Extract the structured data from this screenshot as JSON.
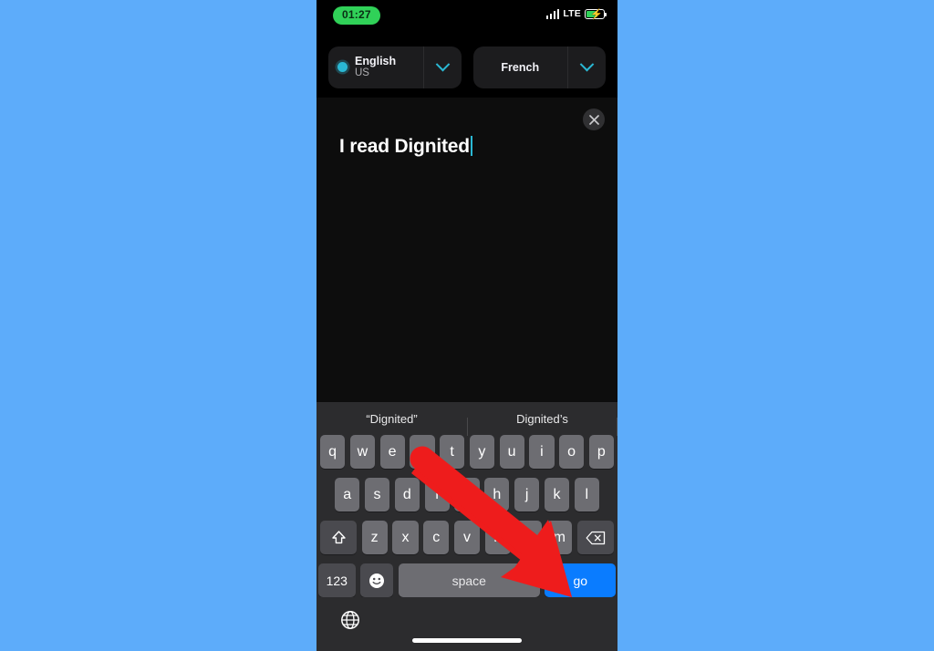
{
  "statusbar": {
    "time": "01:27",
    "network_label": "LTE",
    "signal_icon": "signal-bars-icon",
    "battery_icon": "battery-charging-icon"
  },
  "language_selector": {
    "source": {
      "name": "English",
      "region": "US",
      "selected_indicator": "radio-dot-icon",
      "chevron_icon": "chevron-down-icon"
    },
    "target": {
      "name": "French",
      "chevron_icon": "chevron-down-icon"
    }
  },
  "composer": {
    "close_icon": "close-icon",
    "typed_text": "I read Dignited"
  },
  "keyboard": {
    "suggestions": [
      "“Dignited”",
      "Dignited’s"
    ],
    "row1": [
      "q",
      "w",
      "e",
      "r",
      "t",
      "y",
      "u",
      "i",
      "o",
      "p"
    ],
    "row2": [
      "a",
      "s",
      "d",
      "f",
      "g",
      "h",
      "j",
      "k",
      "l"
    ],
    "row3": [
      "z",
      "x",
      "c",
      "v",
      "b",
      "n",
      "m"
    ],
    "shift_icon": "shift-up-arrow-icon",
    "backspace_icon": "backspace-delete-icon",
    "numeric_label": "123",
    "emoji_icon": "emoji-smiley-icon",
    "space_label": "space",
    "go_label": "go",
    "globe_icon": "globe-language-switch-icon"
  },
  "colors": {
    "wallpaper": "#5dacfa",
    "accent_teal": "#2ab8d4",
    "go_blue": "#0a7cff",
    "time_green": "#30d158",
    "arrow_red": "#ee1c1c",
    "key_gray": "#6d6d72",
    "key_dark": "#4a4a4f"
  },
  "annotation": {
    "arrow_icon": "red-pointer-arrow-icon",
    "points_to": "go"
  }
}
